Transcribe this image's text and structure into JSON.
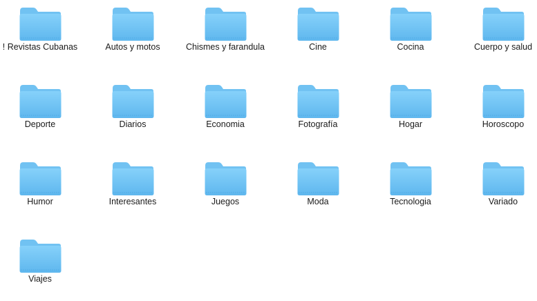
{
  "folder_icon": {
    "name": "folder-icon",
    "back_color": "#71c2f2",
    "front_top_color": "#86d1fa",
    "front_bottom_color": "#5fb7ee",
    "dashed_color": "#4ea9e4"
  },
  "folders": [
    {
      "label": "! Revistas Cubanas"
    },
    {
      "label": "Autos y motos"
    },
    {
      "label": "Chismes y farandula"
    },
    {
      "label": "Cine"
    },
    {
      "label": "Cocina"
    },
    {
      "label": "Cuerpo y salud"
    },
    {
      "label": "Deporte"
    },
    {
      "label": "Diarios"
    },
    {
      "label": "Economia"
    },
    {
      "label": "Fotografía"
    },
    {
      "label": "Hogar"
    },
    {
      "label": "Horoscopo"
    },
    {
      "label": "Humor"
    },
    {
      "label": "Interesantes"
    },
    {
      "label": "Juegos"
    },
    {
      "label": "Moda"
    },
    {
      "label": "Tecnologia"
    },
    {
      "label": "Variado"
    },
    {
      "label": "Viajes"
    }
  ]
}
